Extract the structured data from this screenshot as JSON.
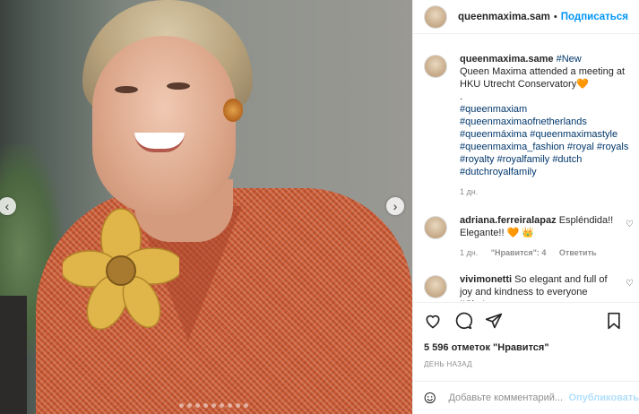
{
  "post": {
    "username": "queenmaxima.sam",
    "follow_label": "Подписаться",
    "separator": "•"
  },
  "caption": {
    "username": "queenmaxima.same",
    "first_tag": "#New",
    "text": "Queen Maxima attended a meeting at HKU Utrecht Conservatory🧡",
    "dot": ".",
    "hashtags_1": "#queenmaxiam",
    "hashtags_2": "#queenmaximaofnetherlands",
    "hashtags_3": "#queenmáxima #queenmaximastyle",
    "hashtags_4": "#queenmaxima_fashion #royal #royals",
    "hashtags_5": "#royalty #royalfamily #dutch",
    "hashtags_6": "#dutchroyalfamily",
    "time": "1 дн."
  },
  "comments": [
    {
      "username": "adriana.ferreiralapaz",
      "text": "Espléndida!! Elegante!! 🧡 👑",
      "time": "1 дн.",
      "likes": "\"Нравится\": 4",
      "reply": "Ответить"
    },
    {
      "username": "vivimonetti",
      "text": "So elegant and full of joy and kindness to everyone !!She's"
    }
  ],
  "stats": {
    "likes": "5 596 отметок \"Нравится\"",
    "date": "ДЕНЬ НАЗАД"
  },
  "add_comment": {
    "placeholder": "Добавьте комментарий...",
    "publish": "Опубликовать"
  },
  "icons": [
    "heart-icon",
    "comment-icon",
    "share-icon",
    "bookmark-icon",
    "emoji-icon",
    "chevron-left-icon",
    "chevron-right-icon"
  ]
}
